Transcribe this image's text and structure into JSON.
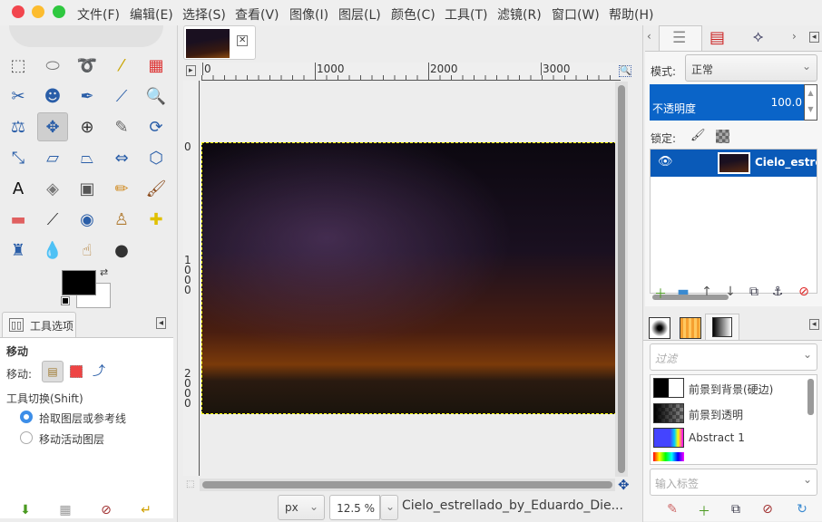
{
  "window": {
    "controls": {
      "close": "#f2464e",
      "minimize": "#fcbc2f",
      "maximize": "#2fc840"
    }
  },
  "menu": [
    "文件(F)",
    "编辑(E)",
    "选择(S)",
    "查看(V)",
    "图像(I)",
    "图层(L)",
    "颜色(C)",
    "工具(T)",
    "滤镜(R)",
    "窗口(W)",
    "帮助(H)"
  ],
  "toolbox": {
    "tools": [
      {
        "name": "rect-select",
        "glyph": "⬚",
        "color": "#555"
      },
      {
        "name": "ellipse-select",
        "glyph": "⬭",
        "color": "#777"
      },
      {
        "name": "free-select",
        "glyph": "➰",
        "color": "#888"
      },
      {
        "name": "fuzzy-select",
        "glyph": "⁄",
        "color": "#c9a400"
      },
      {
        "name": "select-by-color",
        "glyph": "▦",
        "color": "#d33"
      },
      {
        "name": "scissors-select",
        "glyph": "✂",
        "color": "#2a5ea8"
      },
      {
        "name": "foreground-select",
        "glyph": "☻",
        "color": "#2a5ea8"
      },
      {
        "name": "paths",
        "glyph": "✒",
        "color": "#2a5ea8"
      },
      {
        "name": "color-picker",
        "glyph": "⟋",
        "color": "#2a5ea8"
      },
      {
        "name": "zoom",
        "glyph": "🔍",
        "color": "#2a5ea8"
      },
      {
        "name": "measure",
        "glyph": "⚖",
        "color": "#2a5ea8"
      },
      {
        "name": "move",
        "glyph": "✥",
        "color": "#2a5ea8"
      },
      {
        "name": "align",
        "glyph": "⊕",
        "color": "#333"
      },
      {
        "name": "crop",
        "glyph": "✎",
        "color": "#666"
      },
      {
        "name": "rotate",
        "glyph": "⟳",
        "color": "#2a5ea8"
      },
      {
        "name": "scale",
        "glyph": "⤡",
        "color": "#2a5ea8"
      },
      {
        "name": "shear",
        "glyph": "▱",
        "color": "#2a5ea8"
      },
      {
        "name": "perspective",
        "glyph": "⏢",
        "color": "#2a5ea8"
      },
      {
        "name": "flip",
        "glyph": "⇔",
        "color": "#2a5ea8"
      },
      {
        "name": "cage-transform",
        "glyph": "⬡",
        "color": "#2a5ea8"
      },
      {
        "name": "text",
        "glyph": "A",
        "color": "#111"
      },
      {
        "name": "bucket-fill",
        "glyph": "◈",
        "color": "#777"
      },
      {
        "name": "blend",
        "glyph": "▣",
        "color": "#555"
      },
      {
        "name": "pencil",
        "glyph": "✏",
        "color": "#d08a20"
      },
      {
        "name": "paintbrush",
        "glyph": "🖌",
        "color": "#8a4a1a"
      },
      {
        "name": "eraser",
        "glyph": "▬",
        "color": "#e06060"
      },
      {
        "name": "airbrush",
        "glyph": "⟋",
        "color": "#333"
      },
      {
        "name": "ink",
        "glyph": "◉",
        "color": "#2a5ea8"
      },
      {
        "name": "clone",
        "glyph": "♙",
        "color": "#b07a30"
      },
      {
        "name": "heal",
        "glyph": "✚",
        "color": "#e0c000"
      },
      {
        "name": "perspective-clone",
        "glyph": "♜",
        "color": "#2a5ea8"
      },
      {
        "name": "blur-sharpen",
        "glyph": "💧",
        "color": "#4a8ad0"
      },
      {
        "name": "smudge",
        "glyph": "☝",
        "color": "#b07a30"
      },
      {
        "name": "dodge-burn",
        "glyph": "●",
        "color": "#333"
      }
    ],
    "fg_color": "#000000",
    "bg_color": "#ffffff"
  },
  "tool_options": {
    "tab_label": "工具选项",
    "title": "移动",
    "move_label": "移动:",
    "switch_label": "工具切换(Shift)",
    "options": [
      {
        "label": "拾取图层或参考线",
        "checked": true
      },
      {
        "label": "移动活动图层",
        "checked": false
      }
    ]
  },
  "canvas": {
    "ruler_h": [
      "0",
      "1000",
      "2000",
      "3000"
    ],
    "ruler_v": [
      "0",
      "1000",
      "2000"
    ],
    "unit": "px",
    "zoom": "12.5 %",
    "title": "Cielo_estrellado_by_Eduardo_Die..."
  },
  "layers": {
    "mode_label": "模式:",
    "mode_value": "正常",
    "opacity_label": "不透明度",
    "opacity_value": "100.0",
    "lock_label": "锁定:",
    "layer_name": "Cielo_estrel"
  },
  "gradients": {
    "filter_placeholder": "过滤",
    "items": [
      "前景到背景(硬边)",
      "前景到透明",
      "Abstract 1"
    ],
    "tag_placeholder": "输入标签"
  },
  "accent": "#0a64c8"
}
